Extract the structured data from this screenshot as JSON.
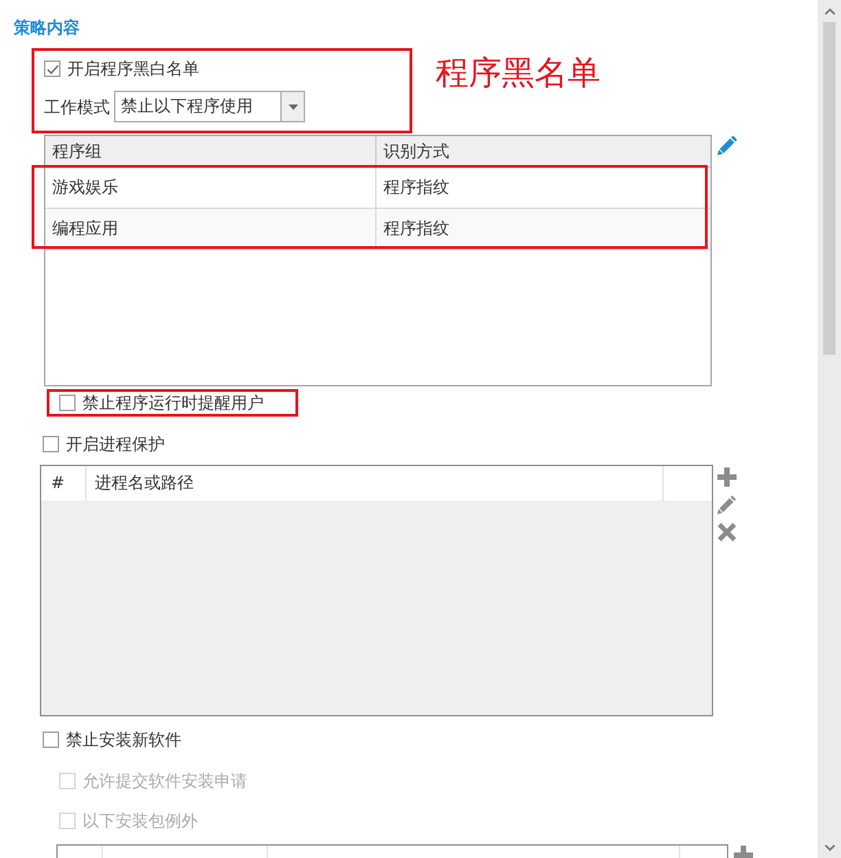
{
  "section_title": "策略内容",
  "blacklist_group": {
    "highlighted": true,
    "enable": {
      "label": "开启程序黑白名单",
      "checked": true
    },
    "mode": {
      "label": "工作模式",
      "value": "禁止以下程序使用"
    }
  },
  "annotation": "程序黑名单",
  "program_table": {
    "columns": [
      "程序组",
      "识别方式"
    ],
    "rows_highlighted": true,
    "rows": [
      {
        "cells": [
          "游戏娱乐",
          "程序指纹"
        ]
      },
      {
        "cells": [
          "编程应用",
          "程序指纹"
        ]
      }
    ]
  },
  "remind_user": {
    "label": "禁止程序运行时提醒用户",
    "checked": false,
    "highlighted": true
  },
  "process_protection": {
    "label": "开启进程保护",
    "checked": false
  },
  "process_table": {
    "columns": [
      "#",
      "进程名或路径"
    ]
  },
  "block_install": {
    "label": "禁止安装新软件",
    "checked": false
  },
  "install_suboptions": [
    {
      "label": "允许提交软件安装申请",
      "checked": false,
      "disabled": true
    },
    {
      "label": "以下安装包例外",
      "checked": false,
      "disabled": true
    }
  ]
}
